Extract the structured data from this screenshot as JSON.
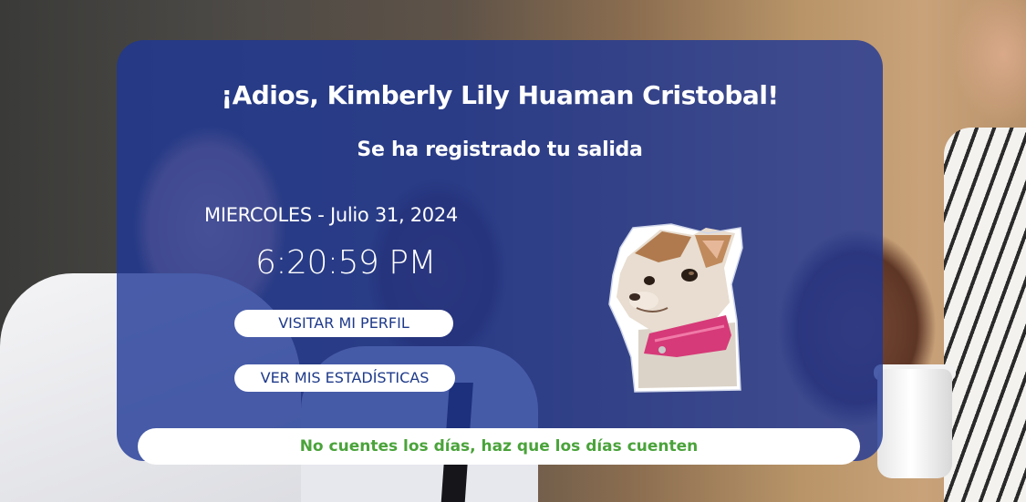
{
  "greeting": "¡Adios, Kimberly Lily Huaman Cristobal!",
  "status_message": "Se ha registrado tu salida",
  "date_text": "MIERCOLES - Julio 31, 2024",
  "time_text": "6:20:59 PM",
  "buttons": {
    "profile_label": "VISITAR MI PERFIL",
    "stats_label": "VER MIS ESTADÍSTICAS"
  },
  "quote": "No cuentes los días, haz que los días cuenten",
  "icons": {
    "sticker": "chihuahua-sticker"
  },
  "colors": {
    "card_bg": "#1e3796",
    "button_text": "#1e3a8a",
    "quote_text": "#4aa33a",
    "dog_collar": "#d63a78"
  }
}
